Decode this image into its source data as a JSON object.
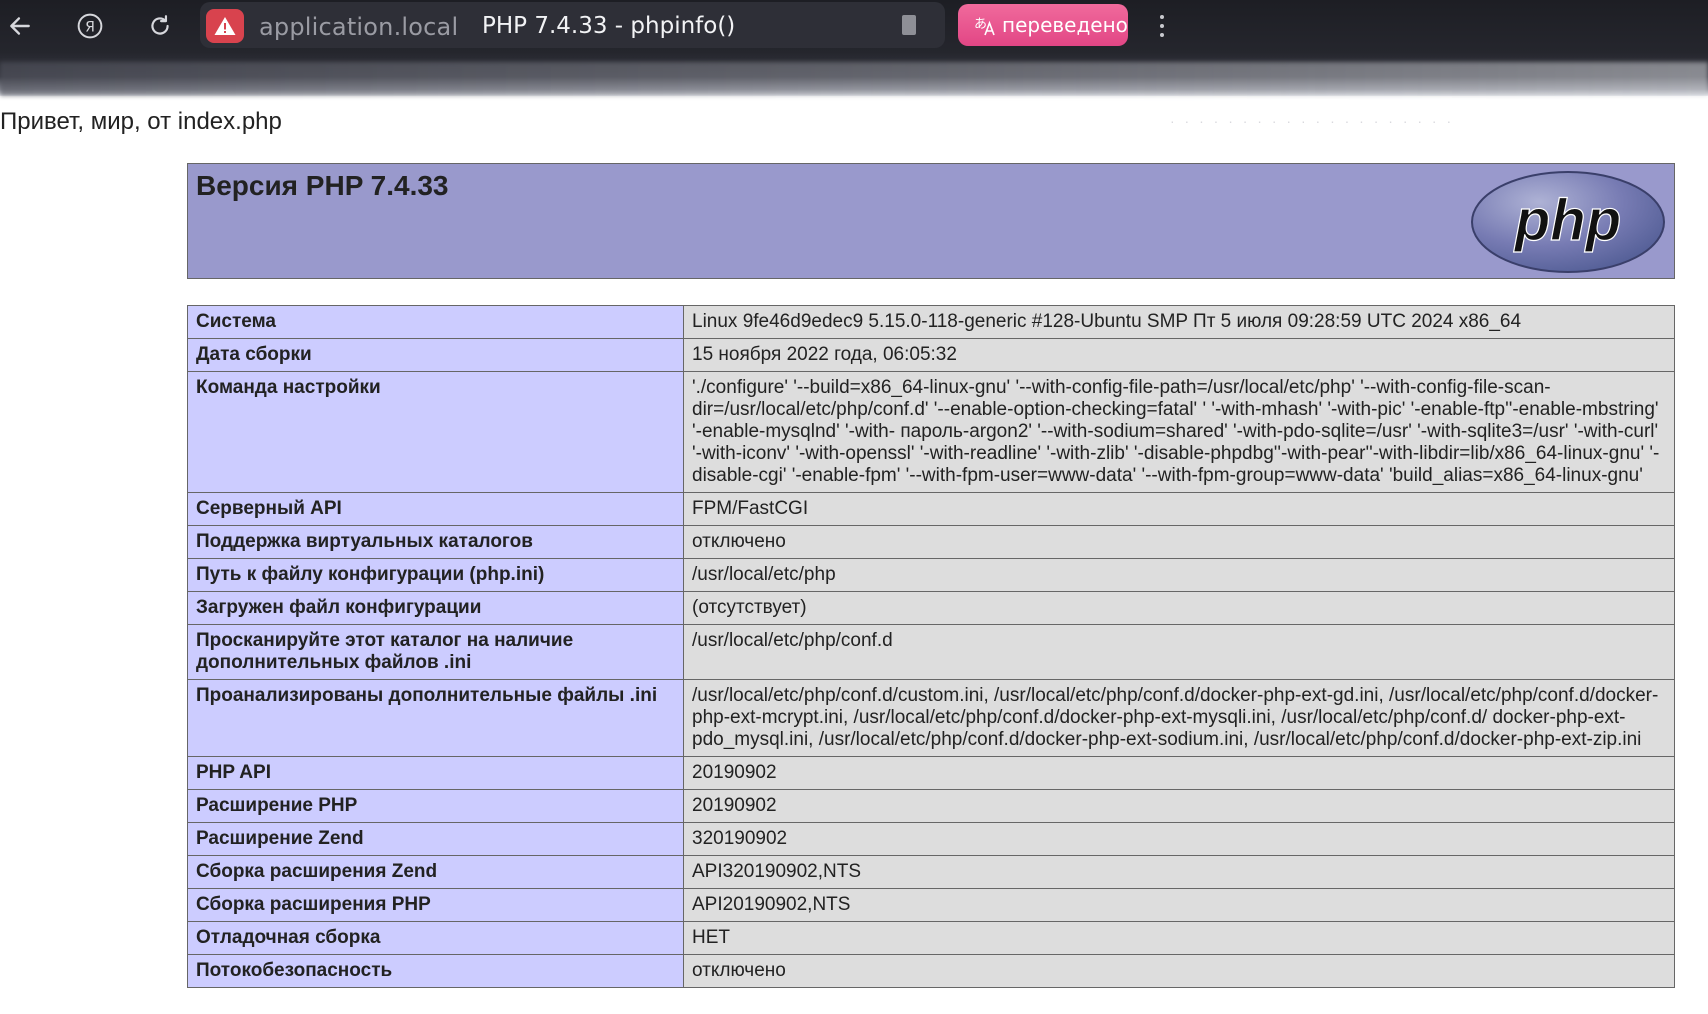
{
  "browser": {
    "url_host": "application.local",
    "tab_title": "PHP 7.4.33 - phpinfo()",
    "translate_label": "переведено"
  },
  "page": {
    "greeting": "Привет, мир, от index.php",
    "header_title": "Версия PHP 7.4.33",
    "logo_text": "php",
    "rows": [
      {
        "key": "Система",
        "value": "Linux 9fe46d9edec9 5.15.0-118-generic #128-Ubuntu SMP Пт 5 июля 09:28:59 UTC 2024 x86_64"
      },
      {
        "key": "Дата сборки",
        "value": "15 ноября 2022 года, 06:05:32"
      },
      {
        "key": "Команда настройки",
        "value": "'./configure' '--build=x86_64-linux-gnu' '--with-config-file-path=/usr/local/etc/php' '--with-config-file-scan-dir=/usr/local/etc/php/conf.d' '--enable-option-checking=fatal' ' '-with-mhash' '-with-pic' '-enable-ftp''-enable-mbstring' '-enable-mysqlnd' '-with- пароль-argon2' '--with-sodium=shared' '-with-pdo-sqlite=/usr' '-with-sqlite3=/usr' '-with-curl' '-with-iconv' '-with-openssl' '-with-readline' '-with-zlib' '-disable-phpdbg''-with-pear''-with-libdir=lib/x86_64-linux-gnu' '-disable-cgi' '-enable-fpm' '--with-fpm-user=www-data' '--with-fpm-group=www-data' 'build_alias=x86_64-linux-gnu'"
      },
      {
        "key": "Серверный API",
        "value": "FPM/FastCGI"
      },
      {
        "key": "Поддержка виртуальных каталогов",
        "value": "отключено"
      },
      {
        "key": "Путь к файлу конфигурации (php.ini)",
        "value": "/usr/local/etc/php"
      },
      {
        "key": "Загружен файл конфигурации",
        "value": "(отсутствует)"
      },
      {
        "key": "Просканируйте этот каталог на наличие дополнительных файлов .ini",
        "value": "/usr/local/etc/php/conf.d"
      },
      {
        "key": "Проанализированы дополнительные файлы .ini",
        "value": "/usr/local/etc/php/conf.d/custom.ini, /usr/local/etc/php/conf.d/docker-php-ext-gd.ini, /usr/local/etc/php/conf.d/docker-php-ext-mcrypt.ini, /usr/local/etc/php/conf.d/docker-php-ext-mysqli.ini, /usr/local/etc/php/conf.d/ docker-php-ext-pdo_mysql.ini, /usr/local/etc/php/conf.d/docker-php-ext-sodium.ini, /usr/local/etc/php/conf.d/docker-php-ext-zip.ini"
      },
      {
        "key": "PHP API",
        "value": "20190902"
      },
      {
        "key": "Расширение PHP",
        "value": "20190902"
      },
      {
        "key": "Расширение Zend",
        "value": "320190902"
      },
      {
        "key": "Сборка расширения Zend",
        "value": "API320190902,NTS"
      },
      {
        "key": "Сборка расширения PHP",
        "value": "API20190902,NTS"
      },
      {
        "key": "Отладочная сборка",
        "value": "НЕТ"
      },
      {
        "key": "Потокобезопасность",
        "value": "отключено"
      }
    ]
  },
  "colors": {
    "header_bg": "#9999cc",
    "key_cell_bg": "#ccccff",
    "value_cell_bg": "#dddddd",
    "translate_accent": "#e24685",
    "warning_badge": "#d8434e"
  },
  "icons": [
    "back-arrow-icon",
    "yandex-icon",
    "reload-icon",
    "warning-icon",
    "bookmark-icon",
    "translate-icon",
    "more-menu-icon"
  ]
}
